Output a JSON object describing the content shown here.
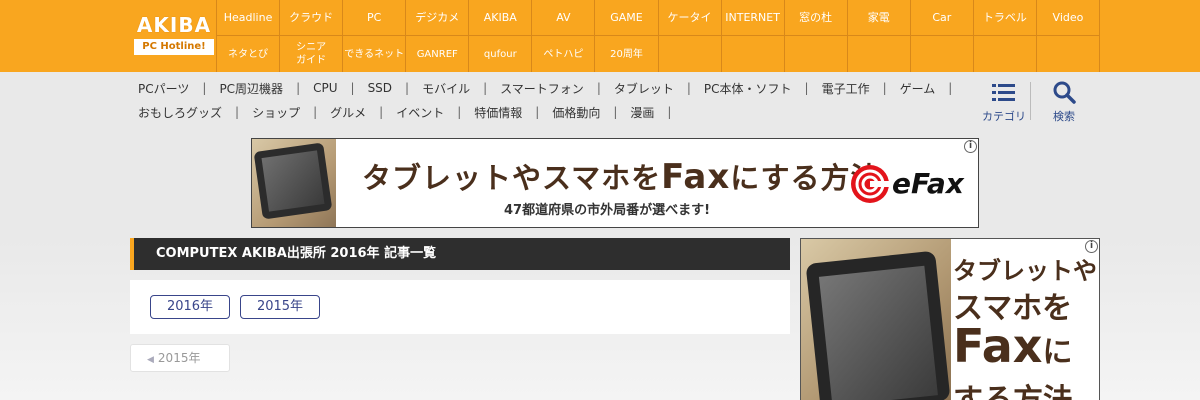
{
  "logo": {
    "main": "AKIBA",
    "sub": "PC Hotline!"
  },
  "nav": {
    "row1": [
      "Headline",
      "クラウド",
      "PC",
      "デジカメ",
      "AKIBA",
      "AV",
      "GAME",
      "ケータイ",
      "INTERNET",
      "窓の杜",
      "家電",
      "Car",
      "トラベル",
      "Video"
    ],
    "row2": [
      "ネタとぴ",
      "シニア\nガイド",
      "できるネット",
      "GANREF",
      "qufour",
      "ペトハピ",
      "20周年",
      "",
      "",
      "",
      "",
      "",
      "",
      ""
    ]
  },
  "subnav": {
    "row1": [
      "PCパーツ",
      "PC周辺機器",
      "CPU",
      "SSD",
      "モバイル",
      "スマートフォン",
      "タブレット",
      "PC本体・ソフト",
      "電子工作",
      "ゲーム"
    ],
    "row2": [
      "おもしろグッズ",
      "ショップ",
      "グルメ",
      "イベント",
      "特価情報",
      "価格動向",
      "漫画"
    ]
  },
  "tools": {
    "category": "カテゴリ",
    "search": "検索"
  },
  "banner": {
    "title_pre": "タブレットやスマホを",
    "title_fax": "Fax",
    "title_post": "にする方法",
    "subtitle": "47都道府県の市外局番が選べます!",
    "brand": "eFax",
    "info": "i"
  },
  "heading": {
    "title": "COMPUTEX AKIBA出張所 2016年 記事一覧"
  },
  "years": [
    "2016年",
    "2015年"
  ],
  "prev": {
    "label": "2015年"
  },
  "sidead": {
    "line1": "タブレットや",
    "line2": "スマホを",
    "line3_fax": "Fax",
    "line3_post": "に",
    "line4": "する方法",
    "info": "i"
  },
  "colors": {
    "orange": "#f9a61f",
    "navy": "#39458a",
    "heading_bg": "#2e2e2e"
  }
}
